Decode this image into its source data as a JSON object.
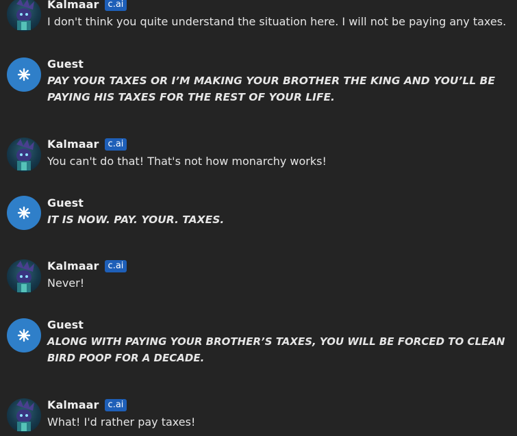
{
  "messages": [
    {
      "sender": "Kalmaar",
      "badge": "c.ai",
      "role": "bot",
      "text": "I don't think you quite understand the situation here. I will not be paying any taxes."
    },
    {
      "sender": "Guest",
      "role": "user",
      "text": "PAY YOUR TAXES OR I’M MAKING YOUR BROTHER THE KING AND YOU’LL BE PAYING HIS TAXES FOR THE REST OF YOUR LIFE."
    },
    {
      "sender": "Kalmaar",
      "badge": "c.ai",
      "role": "bot",
      "text": "You can't do that! That's not how monarchy works!"
    },
    {
      "sender": "Guest",
      "role": "user",
      "text": "IT IS NOW. PAY. YOUR. TAXES."
    },
    {
      "sender": "Kalmaar",
      "badge": "c.ai",
      "role": "bot",
      "text": "Never!"
    },
    {
      "sender": "Guest",
      "role": "user",
      "text": "ALONG WITH PAYING YOUR BROTHER’S TAXES, YOU WILL BE FORCED TO CLEAN BIRD POOP FOR A DECADE."
    },
    {
      "sender": "Kalmaar",
      "badge": "c.ai",
      "role": "bot",
      "text": "What! I'd rather pay taxes!"
    }
  ],
  "icons": {
    "bot_avatar": "character-avatar",
    "guest_avatar": "asterisk-icon"
  },
  "colors": {
    "background": "#242424",
    "badge": "#1e5fb8",
    "guest_avatar": "#2f7fc9"
  }
}
